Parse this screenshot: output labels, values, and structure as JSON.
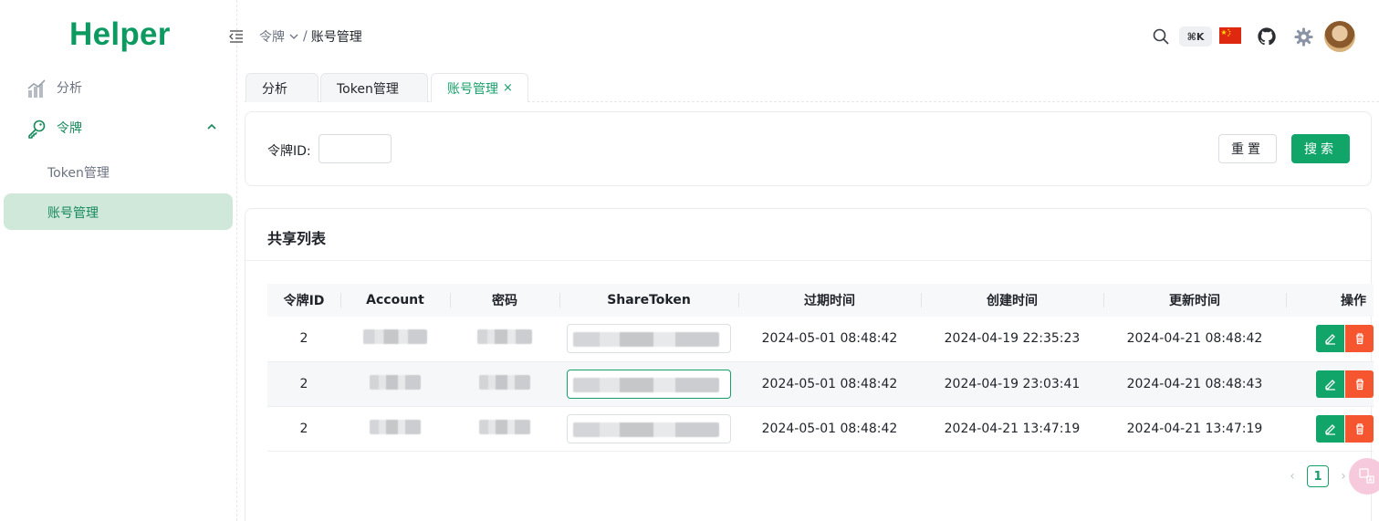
{
  "app": {
    "logo": "Helper",
    "accent": "#12a56a"
  },
  "sidebar": {
    "items": [
      {
        "label": "分析",
        "icon": "chart-icon"
      },
      {
        "label": "令牌",
        "icon": "key-icon",
        "expanded": true,
        "children": [
          {
            "label": "Token管理"
          },
          {
            "label": "账号管理",
            "active": true
          }
        ]
      }
    ]
  },
  "header": {
    "breadcrumb": {
      "parent": "令牌",
      "separator": "/",
      "current": "账号管理"
    },
    "shortcut": "⌘K"
  },
  "tabs": [
    {
      "label": "分析"
    },
    {
      "label": "Token管理"
    },
    {
      "label": "账号管理",
      "active": true,
      "close": "×"
    }
  ],
  "search": {
    "label": "令牌ID:",
    "value": "",
    "reset_label": "重置",
    "search_label": "搜索"
  },
  "list": {
    "title": "共享列表",
    "columns": [
      "令牌ID",
      "Account",
      "密码",
      "ShareToken",
      "过期时间",
      "创建时间",
      "更新时间",
      "操作"
    ],
    "rows": [
      {
        "token_id": "2",
        "expire": "2024-05-01 08:48:42",
        "created": "2024-04-19 22:35:23",
        "updated": "2024-04-21 08:48:42"
      },
      {
        "token_id": "2",
        "expire": "2024-05-01 08:48:42",
        "created": "2024-04-19 23:03:41",
        "updated": "2024-04-21 08:48:43"
      },
      {
        "token_id": "2",
        "expire": "2024-05-01 08:48:42",
        "created": "2024-04-21 13:47:19",
        "updated": "2024-04-21 13:47:19"
      }
    ]
  },
  "pagination": {
    "prev": "‹",
    "page": "1",
    "next": "›"
  }
}
